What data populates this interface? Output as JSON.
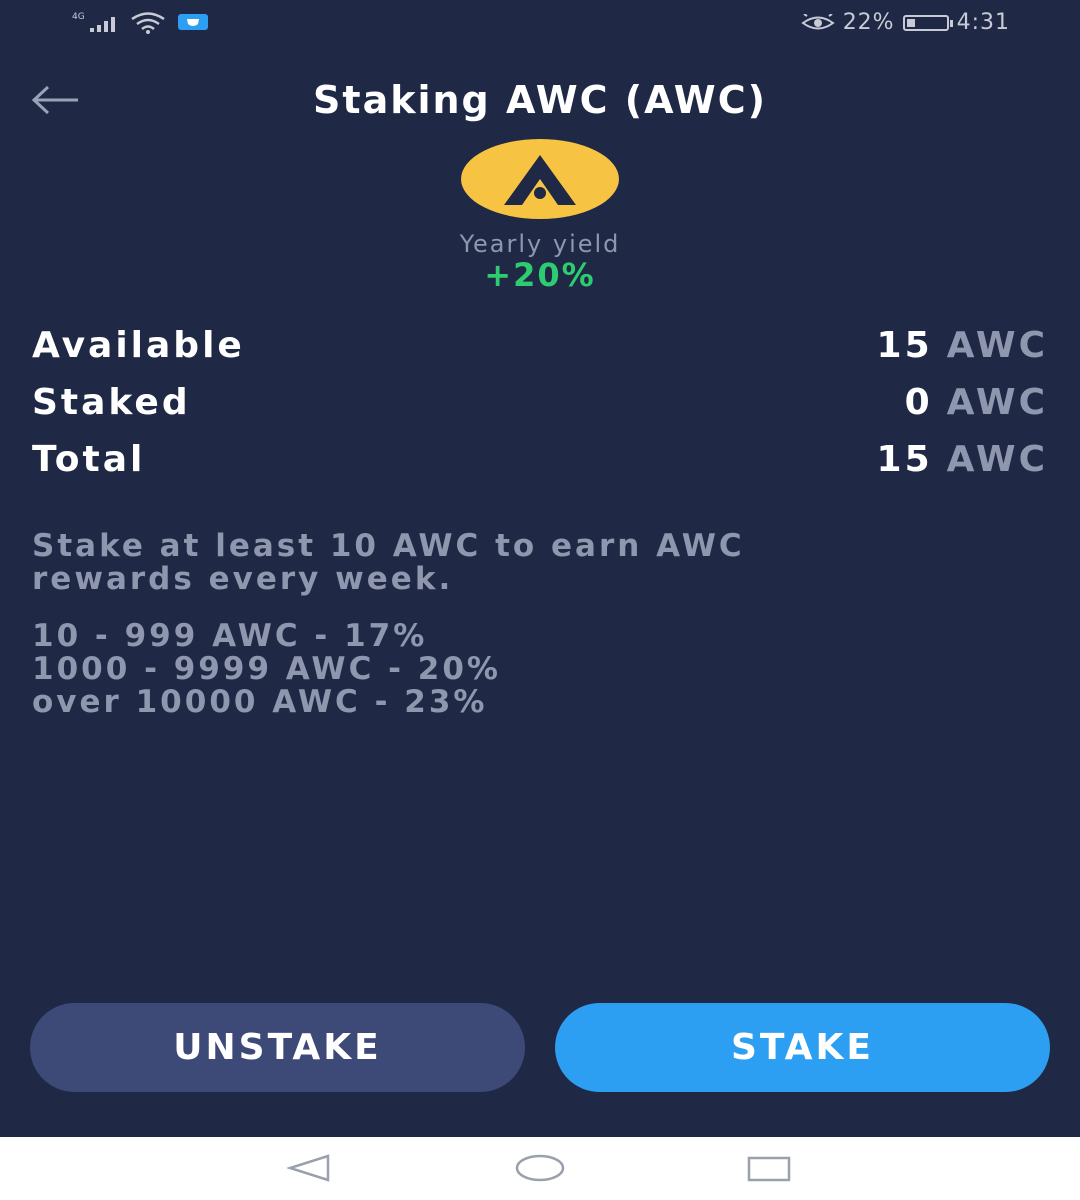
{
  "status_bar": {
    "network": "4G",
    "battery_percent": "22%",
    "battery_level": 0.22,
    "time": "4:31",
    "icons": [
      "signal-icon",
      "wifi-icon",
      "app-notification-icon",
      "eye-comfort-icon",
      "battery-icon"
    ]
  },
  "header": {
    "title": "Staking AWC (AWC)",
    "back_icon": "back-arrow-icon"
  },
  "token": {
    "logo_icon": "awc-logo-icon",
    "logo_color": "#f6c343",
    "yield_label": "Yearly yield",
    "yield_value": "+20%"
  },
  "balances": [
    {
      "label": "Available",
      "amount": "15",
      "unit": "AWC"
    },
    {
      "label": "Staked",
      "amount": "0",
      "unit": "AWC"
    },
    {
      "label": "Total",
      "amount": "15",
      "unit": "AWC"
    }
  ],
  "info": {
    "description_line1": "Stake at least 10 AWC to earn AWC",
    "description_line2": "rewards every week.",
    "tiers": [
      "10 - 999 AWC - 17%",
      "1000 - 9999 AWC - 20%",
      "over 10000 AWC - 23%"
    ]
  },
  "actions": {
    "unstake_label": "UNSTAKE",
    "stake_label": "STAKE",
    "stake_color": "#2d9ff2",
    "unstake_color": "#3d4a78"
  },
  "nav": {
    "icons": [
      "nav-back-icon",
      "nav-home-icon",
      "nav-recents-icon"
    ]
  },
  "colors": {
    "background": "#1f2946",
    "muted_text": "#8e97ad",
    "positive": "#2ecc71"
  }
}
